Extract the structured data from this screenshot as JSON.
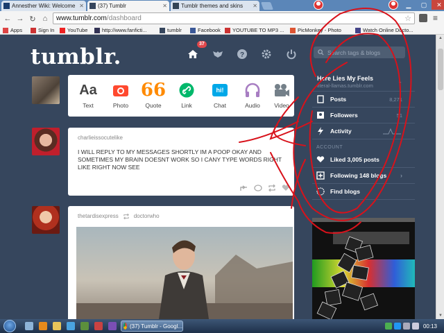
{
  "browser": {
    "tabs": [
      {
        "label": "Annesther Wiki: Welcome",
        "active": false
      },
      {
        "label": "(37) Tumblr",
        "active": true
      },
      {
        "label": "Tumblr themes and skins",
        "active": false
      }
    ],
    "url_host": "www.tumblr.com",
    "url_path": "/dashboard",
    "bookmarks": [
      "Apps",
      "Sign In",
      "YouTube",
      "http://www.fanficti...",
      "tumblr",
      "Facebook",
      "YOUTUBE TO MP3 ...",
      "PicMonkey - Photo",
      "Watch Online Docto..."
    ]
  },
  "tumblr": {
    "logo": "tumblr.",
    "notifications_badge": "37",
    "search_placeholder": "Search tags & blogs",
    "post_types": [
      "Text",
      "Photo",
      "Quote",
      "Link",
      "Chat",
      "Audio",
      "Video"
    ],
    "post_type_icon_text": [
      "Aa",
      "66",
      "hi!"
    ],
    "post1": {
      "author": "charlieissocutelike",
      "body": "I WILL REPLY TO MY MESSAGES SHORTLY IM A POOP OKAY AND SOMETIMES MY BRAIN DOESNT WORK SO I CANY TYPE WORDS RIGHT LIKE RIGHT NOW SEE"
    },
    "post2": {
      "author": "thetardisexpress",
      "reblogged_from": "doctorwho"
    },
    "sidebar": {
      "blog_name": "Here Lies My Feels",
      "blog_url": "literal-llamas.tumblr.com",
      "rows": [
        {
          "label": "Posts",
          "count": "8,271"
        },
        {
          "label": "Followers",
          "count": "51"
        },
        {
          "label": "Activity",
          "count": ""
        }
      ],
      "account_heading": "ACCOUNT",
      "account_rows": [
        "Liked 3,005 posts",
        "Following 148 blogs",
        "Find blogs"
      ]
    },
    "colors": {
      "background": "#36465d",
      "badge": "#e2474b",
      "photo_icon": "#ff492f",
      "quote_icon": "#ff8a00",
      "link_icon": "#00b86b",
      "chat_icon": "#00a8e8",
      "audio_icon": "#a77dc2",
      "video_icon": "#748089"
    }
  },
  "taskbar": {
    "task_label": "(37) Tumblr - Googl...",
    "clock": "00:13"
  }
}
